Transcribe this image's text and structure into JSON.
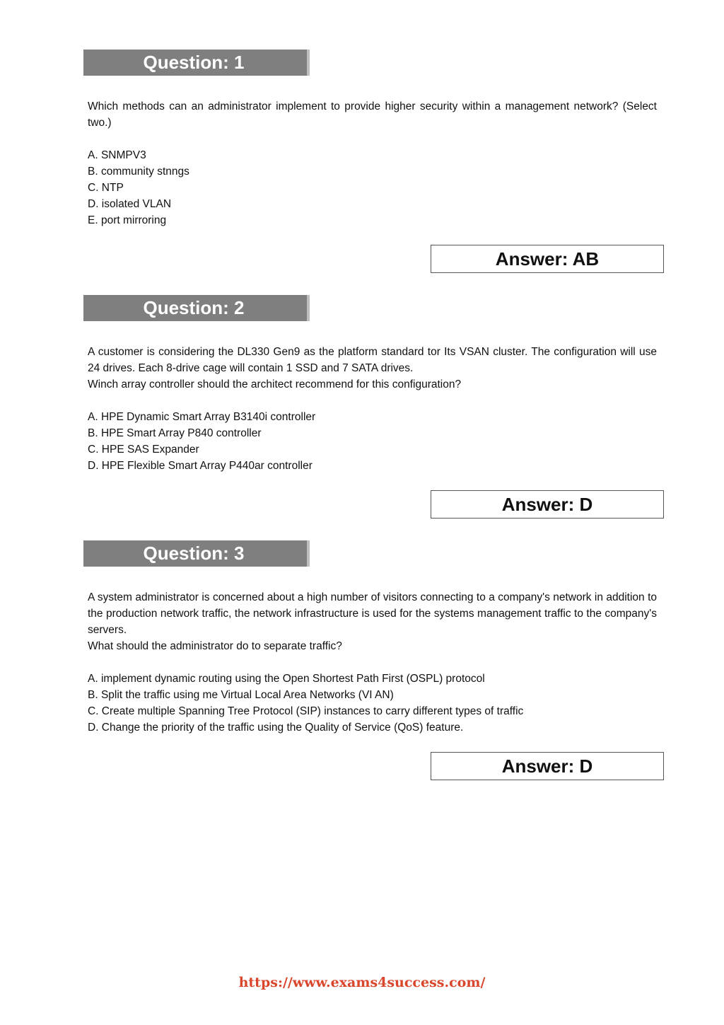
{
  "questions": [
    {
      "header": "Question: 1",
      "text_lines": [
        "Which methods can an administrator implement to provide higher security within a management network? (Select two.)"
      ],
      "options": [
        "A. SNMPV3",
        "B. community stnngs",
        "C. NTP",
        "D. isolated VLAN",
        "E. port mirroring"
      ],
      "answer": "Answer: AB"
    },
    {
      "header": "Question: 2",
      "text_lines": [
        "A customer is considering the DL330 Gen9 as the platform standard tor Its VSAN cluster. The configuration will use 24 drives. Each 8-drive cage will contain 1 SSD and 7 SATA drives.",
        "Winch array controller should the architect recommend for this configuration?"
      ],
      "options": [
        "A. HPE Dynamic Smart Array B3140i controller",
        "B. HPE Smart Array P840 controller",
        "C. HPE SAS Expander",
        "D. HPE Flexible Smart Array P440ar controller"
      ],
      "answer": "Answer: D"
    },
    {
      "header": "Question: 3",
      "text_lines": [
        "A system administrator is concerned about a high number of visitors connecting to a company's network in addition to the production network traffic, the network infrastructure is used for the systems management traffic to the company's servers.",
        "What should the administrator do to separate traffic?"
      ],
      "options": [
        "A. implement dynamic routing using the Open Shortest Path First (OSPL) protocol",
        "B. Split the traffic using me Virtual Local Area Networks (VI AN)",
        "C. Create multiple Spanning Tree Protocol (SIP) instances to carry different types of traffic",
        "D. Change the priority of the traffic using the Quality of Service (QoS) feature."
      ],
      "answer": "Answer: D"
    }
  ],
  "footer": {
    "link_text": "https://www.exams4success.com/",
    "link_color": "#d9462b"
  },
  "colors": {
    "header_bg": "#7f7f7f",
    "header_text": "#ffffff"
  }
}
